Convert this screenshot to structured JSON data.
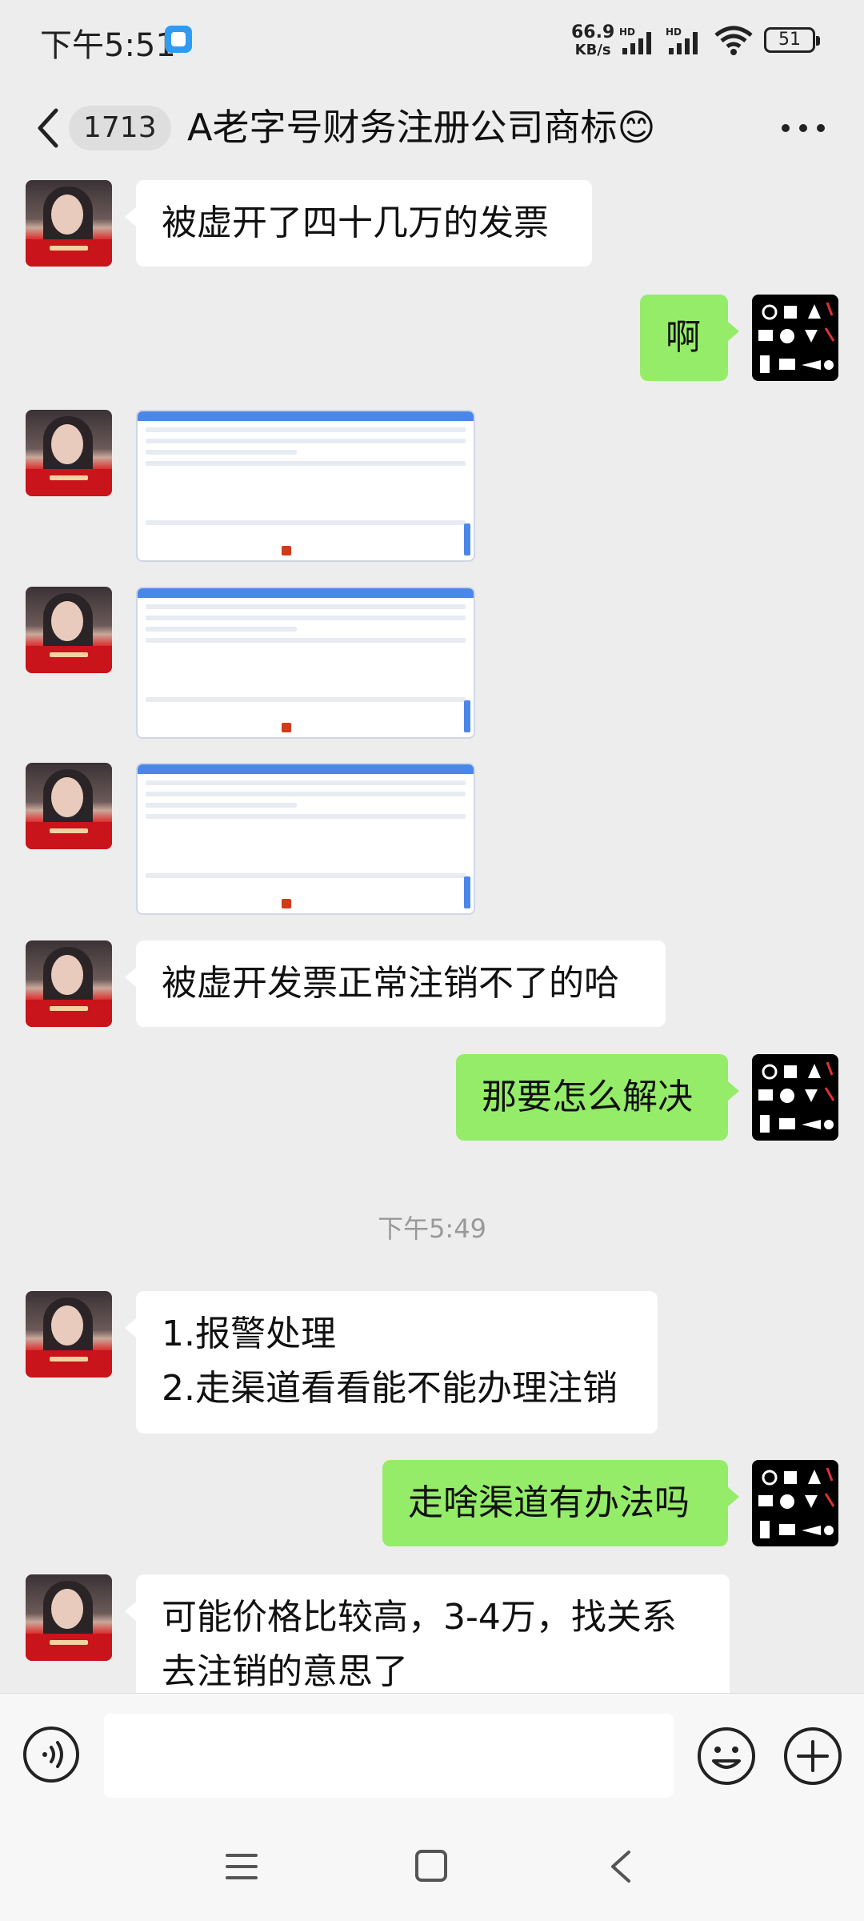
{
  "status_bar": {
    "time": "下午5:51",
    "net_speed_value": "66.9",
    "net_speed_unit": "KB/s",
    "sim1_label": "HD",
    "sim2_label": "HD",
    "battery": "51"
  },
  "header": {
    "unread_count": "1713",
    "title": "A老字号财务注册公司商标😊"
  },
  "messages": [
    {
      "sender": "contact",
      "type": "text",
      "text": "被虚开了四十几万的发票"
    },
    {
      "sender": "me",
      "type": "text",
      "text": "啊"
    },
    {
      "sender": "contact",
      "type": "image"
    },
    {
      "sender": "contact",
      "type": "image"
    },
    {
      "sender": "contact",
      "type": "image"
    },
    {
      "sender": "contact",
      "type": "text",
      "text": "被虚开发票正常注销不了的哈"
    },
    {
      "sender": "me",
      "type": "text",
      "text": "那要怎么解决"
    },
    {
      "type": "timestamp",
      "text": "下午5:49"
    },
    {
      "sender": "contact",
      "type": "text",
      "line1": "1.报警处理",
      "line2": "2.走渠道看看能不能办理注销"
    },
    {
      "sender": "me",
      "type": "text",
      "text": "走啥渠道有办法吗"
    },
    {
      "sender": "contact",
      "type": "text",
      "line1": "可能价格比较高，3-4万，找关系",
      "line2": "去注销的意思了"
    }
  ],
  "input_bar": {
    "placeholder": "",
    "icons": [
      "voice-icon",
      "emoji-icon",
      "plus-icon"
    ]
  },
  "nav_bar": {
    "icons": [
      "menu-icon",
      "home-icon",
      "back-icon"
    ]
  },
  "colors": {
    "background": "#ededed",
    "outgoing_bubble": "#95ec69",
    "incoming_bubble": "#ffffff",
    "timestamp_text": "#999999"
  }
}
